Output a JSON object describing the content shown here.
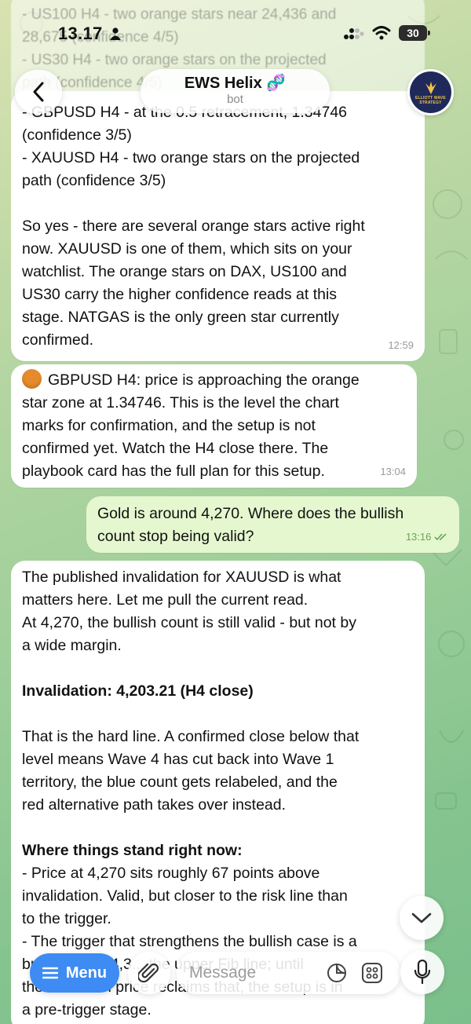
{
  "status_bar": {
    "time": "13.17",
    "battery": "30"
  },
  "header": {
    "title": "EWS Helix 🧬",
    "subtitle": "bot",
    "avatar_text": "ELLIOTT WAVE STRATEGY"
  },
  "faded_top_lines": "- US100 H4 - two orange stars near 24,436 and\n28,675 (confidence 4/5)\n- US30 H4 - two orange stars on the projected\npath (confidence 4/5)\n- GBPUSD H4 - ... (confidence 3/5)",
  "messages": [
    {
      "direction": "in",
      "text": "- GBPUSD H4 - at the 0.5 retracement, 1.34746\n(confidence 3/5)\n- XAUUSD H4 - two orange stars on the projected\npath (confidence 3/5)\n\nSo yes - there are several orange stars active right\nnow. XAUUSD is one of them, which sits on your\nwatchlist. The orange stars on DAX, US100 and\nUS30 carry the higher confidence reads at this\nstage. NATGAS is the only green star currently\nconfirmed.",
      "time": "12:59"
    },
    {
      "direction": "in",
      "emoji": "🟠",
      "text": "GBPUSD H4: price is approaching the orange\nstar zone at 1.34746. This is the level the chart\nmarks for confirmation, and the setup is not\nconfirmed yet. Watch the H4 close there. The\nplaybook card has the full plan for this setup.",
      "time": "13:04"
    },
    {
      "direction": "out",
      "text": "Gold is around 4,270. Where does the bullish\ncount stop being valid?",
      "time": "13:16"
    },
    {
      "direction": "in",
      "p1": "The published invalidation for XAUUSD is what\nmatters here. Let me pull the current read.\nAt 4,270, the bullish count is still valid - but not by\na wide margin.",
      "h1": "Invalidation: 4,203.21 (H4 close)",
      "p2": "That is the hard line. A confirmed close below that\nlevel means Wave 4 has cut back into Wave 1\nterritory, the blue count gets relabeled, and the\nred alternative path takes over instead.",
      "h2": "Where things stand right now:",
      "p3": "- Price at 4,270 sits roughly 67 points above\ninvalidation. Valid, but closer to the risk line than\nto the trigger.\n- The trigger that strengthens the bullish case is a\nbreak above 4,3... the upper Fib line; until\nthe chart ...th price reclaims that, the setup is in\na pre-trigger stage."
    }
  ],
  "composer": {
    "menu_label": "Menu",
    "placeholder": "Message"
  }
}
